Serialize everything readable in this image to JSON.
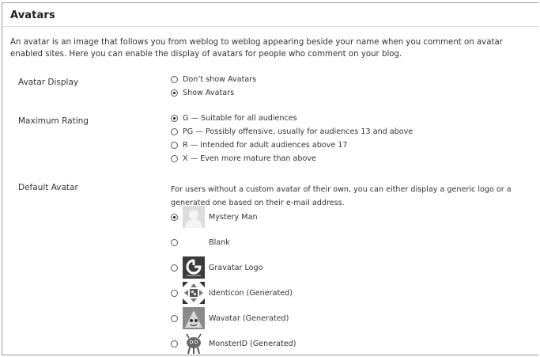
{
  "section": {
    "title": "Avatars",
    "intro_line1": "An avatar is an image that follows you from weblog to weblog appearing beside your name when you comment on avatar",
    "intro_line2": "enabled sites. Here you can enable the display of avatars for people who comment on your blog."
  },
  "avatar_display": {
    "label": "Avatar Display",
    "options": [
      {
        "label": "Don’t show Avatars",
        "selected": false
      },
      {
        "label": "Show Avatars",
        "selected": true
      }
    ]
  },
  "maximum_rating": {
    "label": "Maximum Rating",
    "options": [
      {
        "label": "G — Suitable for all audiences",
        "selected": true
      },
      {
        "label": "PG — Possibly offensive, usually for audiences 13 and above",
        "selected": false
      },
      {
        "label": "R — Intended for adult audiences above 17",
        "selected": false
      },
      {
        "label": "X — Even more mature than above",
        "selected": false
      }
    ]
  },
  "default_avatar": {
    "label": "Default Avatar",
    "description_line1": "For users without a custom avatar of their own, you can either display a generic logo or a",
    "description_line2": "generated one based on their e-mail address.",
    "options": [
      {
        "label": "Mystery Man",
        "selected": true,
        "icon": "mystery-man-icon"
      },
      {
        "label": "Blank",
        "selected": false,
        "icon": "blank-icon"
      },
      {
        "label": "Gravatar Logo",
        "selected": false,
        "icon": "gravatar-logo-icon"
      },
      {
        "label": "Identicon (Generated)",
        "selected": false,
        "icon": "identicon-icon"
      },
      {
        "label": "Wavatar (Generated)",
        "selected": false,
        "icon": "wavatar-icon"
      },
      {
        "label": "MonsterID (Generated)",
        "selected": false,
        "icon": "monsterid-icon"
      }
    ]
  },
  "colors": {
    "text": "#333333",
    "border": "#9a9a9a",
    "divider": "#dadada",
    "gravatar_bg": "#3b3b3b"
  }
}
